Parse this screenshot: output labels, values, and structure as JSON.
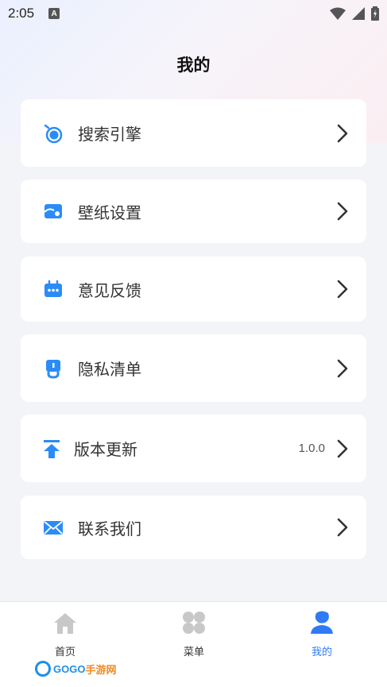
{
  "status_bar": {
    "time": "2:05",
    "notif_icon": "A"
  },
  "header": {
    "title": "我的"
  },
  "menu": [
    {
      "label": "搜索引擎",
      "icon": "search-engine-icon",
      "value": ""
    },
    {
      "label": "壁纸设置",
      "icon": "wallpaper-icon",
      "value": ""
    },
    {
      "label": "意见反馈",
      "icon": "feedback-icon",
      "value": ""
    },
    {
      "label": "隐私清单",
      "icon": "privacy-icon",
      "value": ""
    },
    {
      "label": "版本更新",
      "icon": "update-icon",
      "value": "1.0.0"
    },
    {
      "label": "联系我们",
      "icon": "mail-icon",
      "value": ""
    }
  ],
  "bottom_nav": [
    {
      "label": "首页",
      "icon": "home-icon",
      "active": false
    },
    {
      "label": "菜单",
      "icon": "menu-grid-icon",
      "active": false
    },
    {
      "label": "我的",
      "icon": "profile-icon",
      "active": true
    }
  ],
  "watermark": {
    "brand": "GOGO",
    "suffix": "手游网",
    "url": "www.gogo.cn"
  },
  "colors": {
    "accent": "#2f7bf5",
    "icon_blue": "#2b8cf7",
    "nav_gray": "#c8c8c8",
    "background": "#f3f4f7"
  }
}
